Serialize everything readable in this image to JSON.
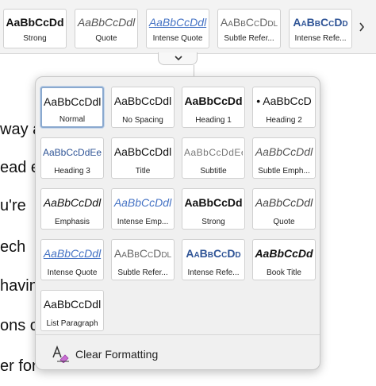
{
  "ribbon": {
    "styles": [
      {
        "sample": "AaBbCcDd",
        "label": "Strong"
      },
      {
        "sample": "AaBbCcDdl",
        "label": "Quote"
      },
      {
        "sample": "AaBbCcDdl",
        "label": "Intense Quote"
      },
      {
        "sample": "AaBbCcDdl",
        "label": "Subtle Refer..."
      },
      {
        "sample": "AaBbCcDd",
        "label": "Intense Refe..."
      }
    ],
    "more_icon": "chevron-right-icon",
    "expand_icon": "chevron-down-icon"
  },
  "document": {
    "fragments": [
      "way a",
      "ead e",
      "u're",
      "ech",
      "havin",
      "ons o",
      "er for"
    ]
  },
  "gallery": {
    "styles": [
      {
        "sample": "AaBbCcDdl",
        "label": "Normal",
        "selected": true
      },
      {
        "sample": "AaBbCcDdl",
        "label": "No Spacing"
      },
      {
        "sample": "AaBbCcDd",
        "label": "Heading 1"
      },
      {
        "sample": "• AaBbCcD",
        "label": "Heading 2"
      },
      {
        "sample": "AaBbCcDdEe",
        "label": "Heading 3"
      },
      {
        "sample": "AaBbCcDdl",
        "label": "Title"
      },
      {
        "sample": "AaBbCcDdEe",
        "label": "Subtitle"
      },
      {
        "sample": "AaBbCcDdl",
        "label": "Subtle Emph..."
      },
      {
        "sample": "AaBbCcDdl",
        "label": "Emphasis"
      },
      {
        "sample": "AaBbCcDdl",
        "label": "Intense Emp..."
      },
      {
        "sample": "AaBbCcDd",
        "label": "Strong"
      },
      {
        "sample": "AaBbCcDdl",
        "label": "Quote"
      },
      {
        "sample": "AaBbCcDdl",
        "label": "Intense Quote"
      },
      {
        "sample": "AaBbCcDdl",
        "label": "Subtle Refer..."
      },
      {
        "sample": "AaBbCcDd",
        "label": "Intense Refe..."
      },
      {
        "sample": "AaBbCcDd",
        "label": "Book Title"
      },
      {
        "sample": "AaBbCcDdl",
        "label": "List Paragraph"
      }
    ]
  },
  "clear_formatting": {
    "label": "Clear Formatting",
    "icon": "clear-formatting-icon"
  },
  "colors": {
    "accent_blue": "#2f5496",
    "link_blue": "#4472c4",
    "selected_border": "#8aa9cf"
  }
}
